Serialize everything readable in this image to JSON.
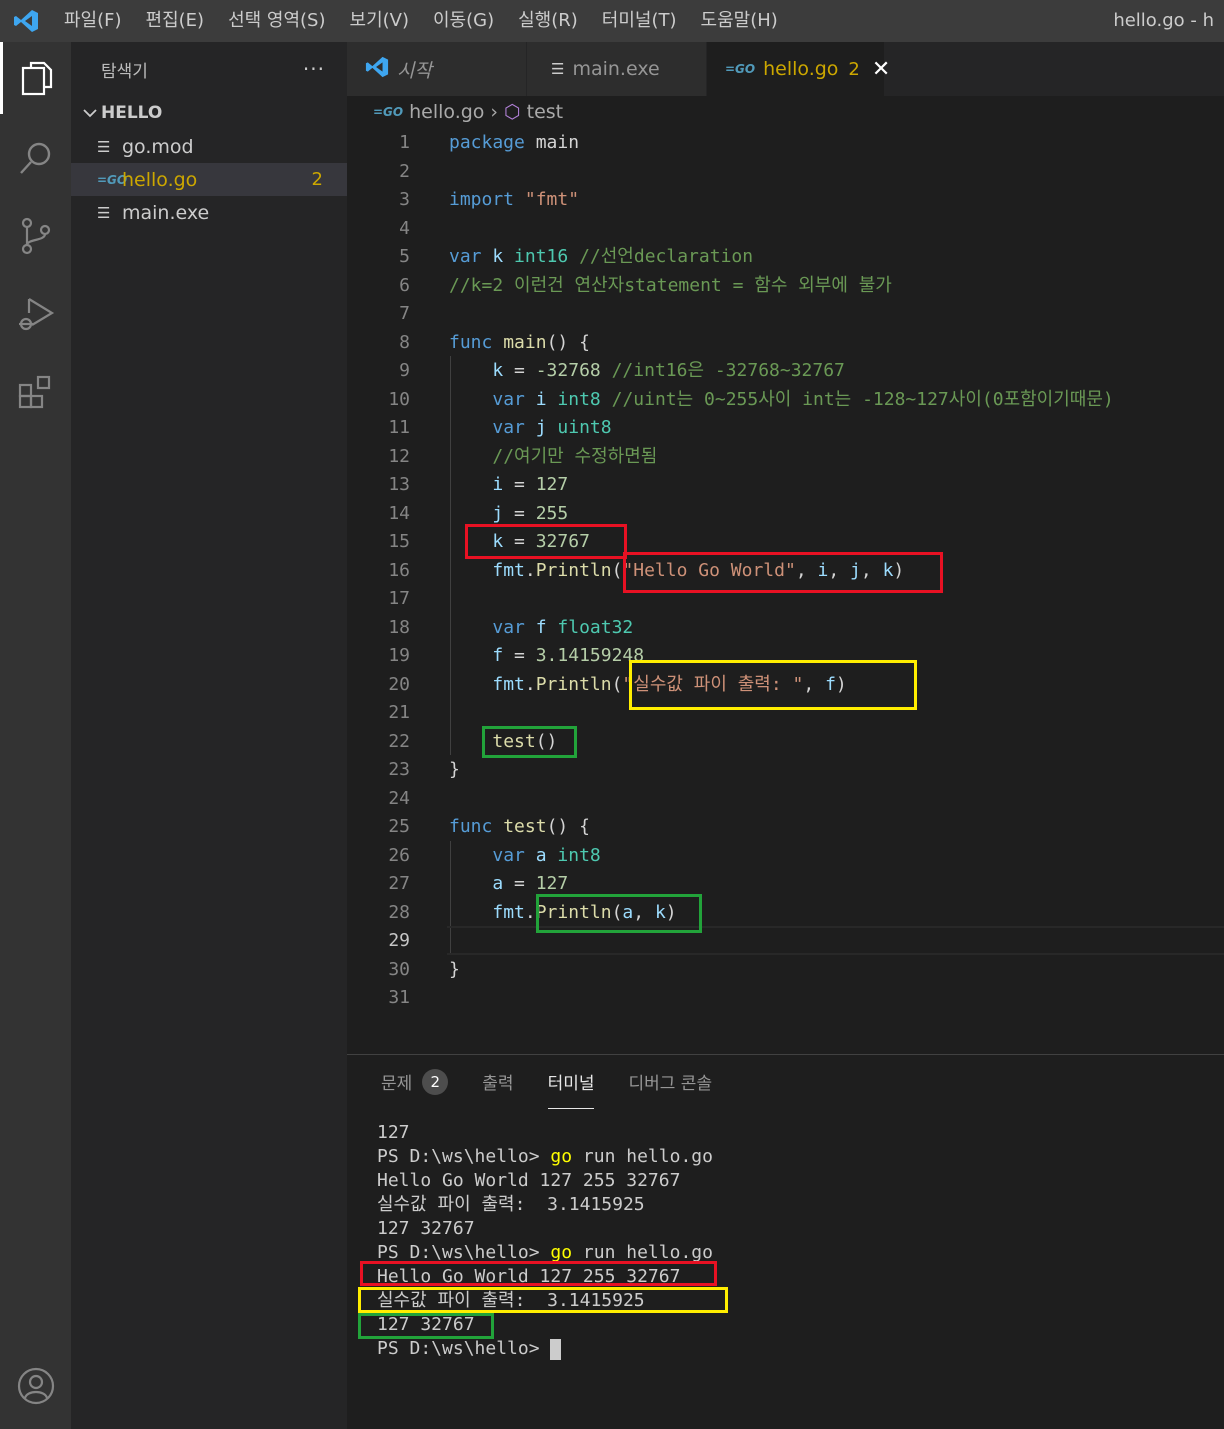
{
  "menubar": {
    "items": [
      "파일(F)",
      "편집(E)",
      "선택 영역(S)",
      "보기(V)",
      "이동(G)",
      "실행(R)",
      "터미널(T)",
      "도움말(H)"
    ],
    "window_title": "hello.go - h"
  },
  "sidebar": {
    "title": "탐색기",
    "more": "···",
    "folder": "HELLO",
    "files": [
      {
        "name": "go.mod",
        "icon": "lines-icon"
      },
      {
        "name": "hello.go",
        "icon": "go-icon",
        "badge": "2"
      },
      {
        "name": "main.exe",
        "icon": "lines-icon"
      }
    ]
  },
  "tabs": [
    {
      "label": "시작",
      "icon": "vscode-icon"
    },
    {
      "label": "main.exe",
      "icon": "lines-icon"
    },
    {
      "label": "hello.go",
      "icon": "go-icon",
      "problems": "2",
      "close": "✕"
    }
  ],
  "breadcrumb": {
    "file": "hello.go",
    "symbol": "test"
  },
  "editor": {
    "current_line": 29,
    "line_numbers": [
      "1",
      "2",
      "3",
      "4",
      "5",
      "6",
      "7",
      "8",
      "9",
      "10",
      "11",
      "12",
      "13",
      "14",
      "15",
      "16",
      "17",
      "18",
      "19",
      "20",
      "21",
      "22",
      "23",
      "24",
      "25",
      "26",
      "27",
      "28",
      "29",
      "30",
      "31"
    ]
  },
  "panel": {
    "tabs": [
      {
        "label": "문제",
        "badge": "2"
      },
      {
        "label": "출력"
      },
      {
        "label": "터미널",
        "active": true
      },
      {
        "label": "디버그 콘솔"
      }
    ],
    "terminal_lines": [
      "127",
      "PS D:\\ws\\hello> go run hello.go",
      "Hello Go World 127 255 32767",
      "실수값 파이 출력:  3.1415925",
      "127 32767",
      "PS D:\\ws\\hello> go run hello.go",
      "Hello Go World 127 255 32767",
      "실수값 파이 출력:  3.1415925",
      "127 32767",
      "PS D:\\ws\\hello> "
    ]
  },
  "colors": {
    "accent_red": "#e81123",
    "accent_yellow": "#ffee00",
    "accent_green": "#22a33a",
    "warning": "#cca700"
  }
}
